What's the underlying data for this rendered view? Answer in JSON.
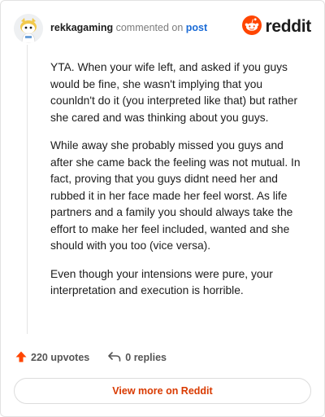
{
  "colors": {
    "reddit_orange": "#ff4500",
    "link_blue": "#1a6bd6",
    "cta_text": "#d93a00"
  },
  "header": {
    "username": "rekkagaming",
    "action": "commented on",
    "target": "post",
    "brand": "reddit",
    "avatar_icon": "snoo-avatar-icon",
    "brand_icon": "reddit-logo-icon"
  },
  "comment": {
    "paragraphs": [
      "YTA. When your wife left, and asked if you guys would be fine, she wasn't implying that you counldn't do it (you interpreted like that) but rather she cared and was thinking about you guys.",
      "While away she probably missed you guys and after she came back the feeling was not mutual. In fact, proving that you guys didnt need her and rubbed it in her face made her feel worst. As life partners and a family you should always take the effort to make her feel included, wanted and she should with you too (vice versa).",
      "Even though your intensions were pure, your interpretation and execution is horrible."
    ]
  },
  "stats": {
    "upvotes": "220 upvotes",
    "replies": "0 replies",
    "upvote_icon": "upvote-arrow-icon",
    "reply_icon": "reply-arrow-icon"
  },
  "cta": {
    "label": "View more on Reddit"
  }
}
